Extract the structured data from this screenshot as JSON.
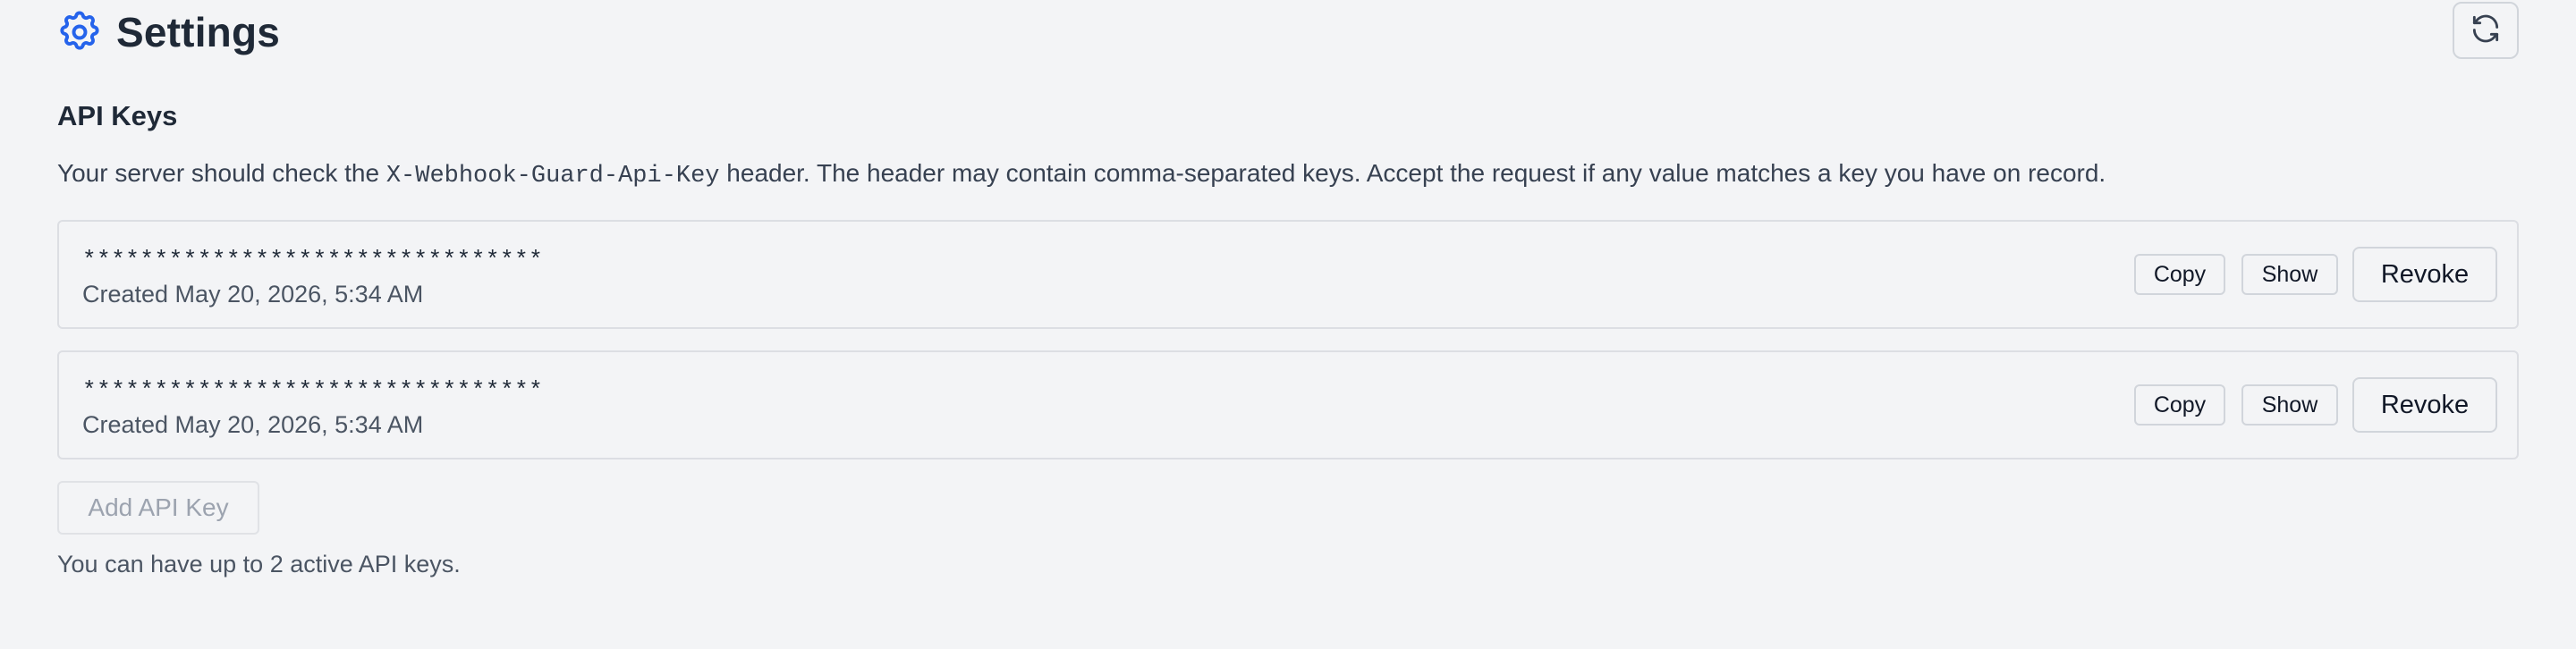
{
  "header": {
    "title": "Settings",
    "icon": "gear-icon",
    "icon_color": "#2563eb",
    "refresh_icon": "refresh-icon"
  },
  "api_keys": {
    "section_title": "API Keys",
    "description_before": "Your server should check the ",
    "header_name": "X-Webhook-Guard-Api-Key",
    "description_after": " header. The header may contain comma-separated keys. Accept the request if any value matches a key you have on record.",
    "keys": [
      {
        "masked": "********************************",
        "created": "Created May 20, 2026, 5:34 AM",
        "copy_label": "Copy",
        "show_label": "Show",
        "revoke_label": "Revoke"
      },
      {
        "masked": "********************************",
        "created": "Created May 20, 2026, 5:34 AM",
        "copy_label": "Copy",
        "show_label": "Show",
        "revoke_label": "Revoke"
      }
    ],
    "add_label": "Add API Key",
    "add_disabled": true,
    "limit_note": "You can have up to 2 active API keys."
  }
}
